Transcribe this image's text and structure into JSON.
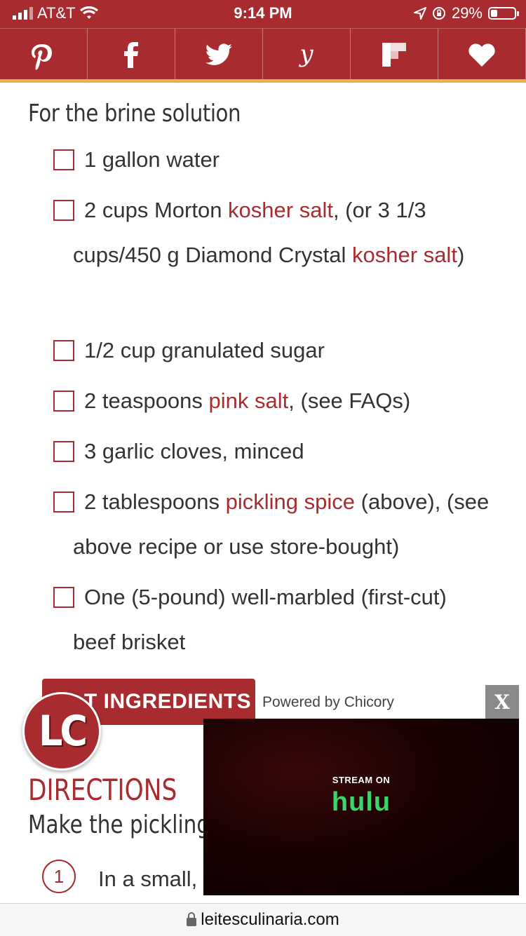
{
  "status_bar": {
    "carrier": "AT&T",
    "time": "9:14 PM",
    "battery": "29%",
    "battery_level": 0.29
  },
  "share_bar": {
    "buttons": [
      {
        "icon": "pinterest-icon"
      },
      {
        "icon": "facebook-icon"
      },
      {
        "icon": "twitter-icon"
      },
      {
        "icon": "yummly-icon"
      },
      {
        "icon": "flipboard-icon"
      },
      {
        "icon": "heart-icon"
      }
    ],
    "colors": {
      "bar": "#a82c2f",
      "accent": "#e2b54a"
    }
  },
  "section_title": "For the brine solution",
  "ingredients": [
    {
      "parts": [
        {
          "text": "1 gallon water"
        }
      ]
    },
    {
      "parts": [
        {
          "text": "2 cups Morton "
        },
        {
          "text": "kosher salt",
          "link": true
        },
        {
          "text": ", (or 3 1/3 cups/450 g Diamond Crystal "
        },
        {
          "text": "kosher salt",
          "link": true
        },
        {
          "text": ")"
        }
      ]
    },
    {
      "parts": [
        {
          "text": "1/2 cup granulated sugar"
        }
      ]
    },
    {
      "parts": [
        {
          "text": "2 teaspoons "
        },
        {
          "text": "pink salt",
          "link": true
        },
        {
          "text": ", (see FAQs)"
        }
      ]
    },
    {
      "parts": [
        {
          "text": "3 garlic cloves, minced"
        }
      ]
    },
    {
      "parts": [
        {
          "text": "2 tablespoons "
        },
        {
          "text": "pickling spice",
          "link": true
        },
        {
          "text": " (above), (see above recipe or use store-bought)"
        }
      ]
    },
    {
      "parts": [
        {
          "text": "One (5-pound) well-marbled (first-cut) beef brisket"
        }
      ]
    }
  ],
  "list_button": "T INGREDIENTS",
  "powered_by": "Powered by Chicory",
  "logo_text": "LC",
  "directions_title": "DIRECTIONS",
  "directions_sub": "Make the pickling s",
  "step": {
    "number": "1",
    "text": "In a small,"
  },
  "ad": {
    "stream_label": "STREAM ON",
    "brand": "hulu",
    "close_label": "X"
  },
  "url": "leitesculinaria.com"
}
